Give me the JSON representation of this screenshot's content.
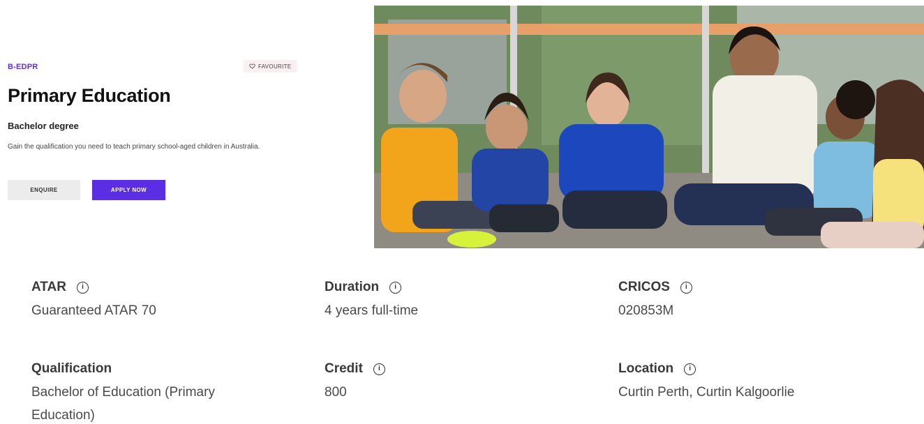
{
  "course": {
    "code": "B-EDPR",
    "favourite_label": "FAVOURITE",
    "title": "Primary Education",
    "degree_type": "Bachelor degree",
    "description": "Gain the qualification you need to teach primary school-aged children in Australia."
  },
  "actions": {
    "enquire_label": "ENQUIRE",
    "apply_label": "APPLY NOW"
  },
  "hero_image": {
    "icon": "photo-classroom"
  },
  "facts": [
    {
      "label": "ATAR",
      "value": "Guaranteed ATAR 70",
      "has_info": true
    },
    {
      "label": "Duration",
      "value": "4 years full-time",
      "has_info": true
    },
    {
      "label": "CRICOS",
      "value": "020853M",
      "has_info": true
    },
    {
      "label": "Qualification",
      "value": "Bachelor of Education (Primary Education)",
      "has_info": false
    },
    {
      "label": "Credit",
      "value": "800",
      "has_info": true
    },
    {
      "label": "Location",
      "value": "Curtin Perth, Curtin Kalgoorlie",
      "has_info": true
    }
  ],
  "icons": {
    "info": "i",
    "favourite": "heart-icon"
  },
  "colors": {
    "accent": "#5b2de3",
    "code": "#5b2fe0",
    "favourite_bg": "#fdf0f2",
    "enquire_bg": "#ececec"
  }
}
